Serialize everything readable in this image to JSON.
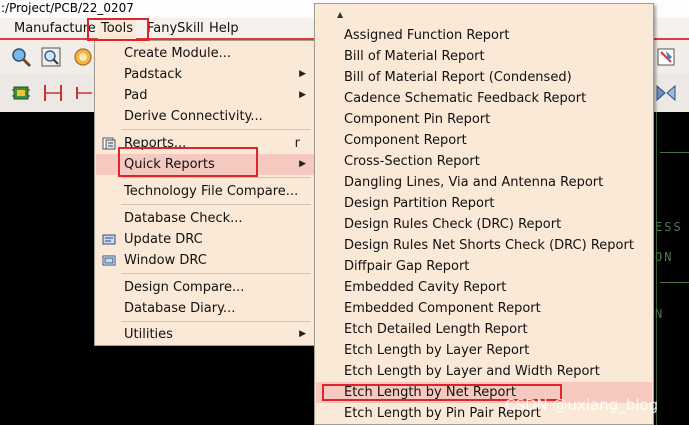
{
  "titlebar": {
    "text": ":/Project/PCB/22_0207"
  },
  "menubar": {
    "items": [
      {
        "label": "Manufacture"
      },
      {
        "label": "Tools"
      },
      {
        "label": "FanySkill"
      },
      {
        "label": "Help"
      }
    ]
  },
  "canvas": {
    "texts": [
      "ESS",
      "ON",
      "N"
    ]
  },
  "tools_menu": {
    "items": [
      {
        "label": "Create Module..."
      },
      {
        "label": "Padstack"
      },
      {
        "label": "Pad"
      },
      {
        "label": "Derive Connectivity..."
      },
      {
        "label": "Reports...",
        "shortcut": "r"
      },
      {
        "label": "Quick Reports"
      },
      {
        "label": "Technology File Compare..."
      },
      {
        "label": "Database Check..."
      },
      {
        "label": "Update DRC"
      },
      {
        "label": "Window DRC"
      },
      {
        "label": "Design Compare..."
      },
      {
        "label": "Database Diary..."
      },
      {
        "label": "Utilities"
      }
    ]
  },
  "quick_reports": {
    "items": [
      "Assigned Function Report",
      "Bill of Material Report",
      "Bill of Material Report (Condensed)",
      "Cadence Schematic Feedback Report",
      "Component Pin Report",
      "Component Report",
      "Cross-Section Report",
      "Dangling Lines, Via and Antenna Report",
      "Design Partition Report",
      "Design Rules Check (DRC) Report",
      "Design Rules Net Shorts Check (DRC) Report",
      "Diffpair Gap Report",
      "Embedded Cavity Report",
      "Embedded Component Report",
      "Etch Detailed Length Report",
      "Etch Length by Layer Report",
      "Etch Length by Layer and Width Report",
      "Etch Length by Net Report",
      "Etch Length by Pin Pair Report"
    ]
  },
  "watermark": {
    "text": "CSDN @uxiang_blog"
  },
  "colors": {
    "menu_bg": "#fbe9d7",
    "highlight": "#f6c9c0",
    "annotation": "#e0242b"
  }
}
